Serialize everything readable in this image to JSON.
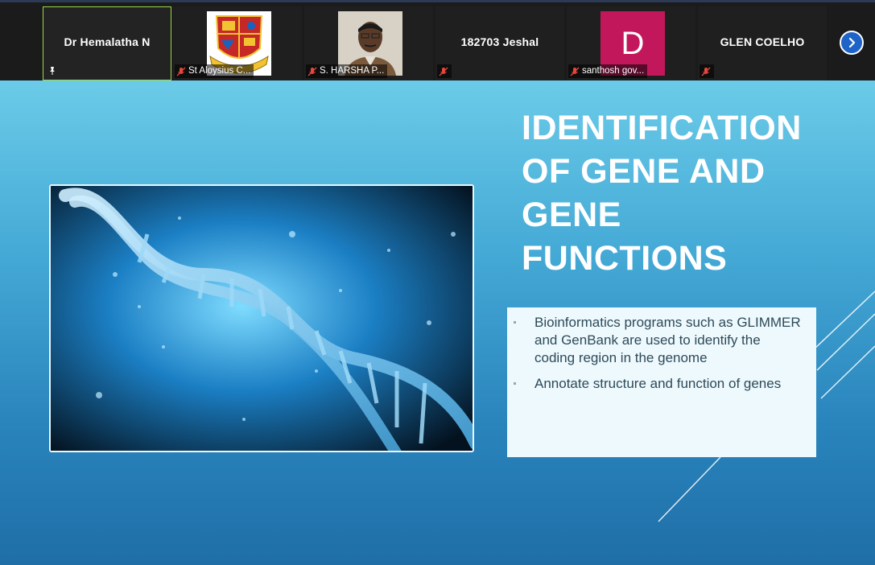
{
  "participants": [
    {
      "name": "Dr Hemalatha N",
      "type": "name",
      "active": true
    },
    {
      "name": "St Aloysius C...",
      "type": "crest"
    },
    {
      "name": "S. HARSHA P...",
      "type": "photo"
    },
    {
      "name": "182703 Jeshal",
      "type": "name"
    },
    {
      "name": "santhosh gov...",
      "type": "avatar",
      "initial": "D",
      "avatar_color": "#c2185b"
    },
    {
      "name": "GLEN COELHO",
      "type": "name"
    }
  ],
  "slide": {
    "title_lines": [
      "IDENTIFICATION",
      "OF GENE AND",
      "GENE",
      "FUNCTIONS"
    ],
    "bullets": [
      "Bioinformatics programs such as GLIMMER and GenBank are used to identify the coding region in the genome",
      "Annotate structure and function of genes"
    ]
  },
  "icons": {
    "pin": "pin-icon",
    "mute": "microphone-muted-icon",
    "next": "chevron-right-icon"
  },
  "colors": {
    "active_border": "#9bd84a",
    "mute_red": "#e8473c",
    "next_button": "#1e64c8"
  }
}
